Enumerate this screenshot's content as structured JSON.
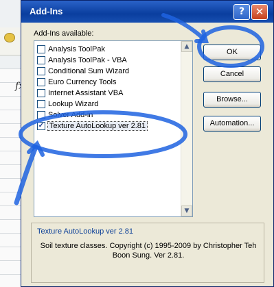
{
  "window": {
    "title": "Add-Ins",
    "help_glyph": "?",
    "close_glyph": "✕"
  },
  "background": {
    "formula_glyph": "fx"
  },
  "addins": {
    "label": "Add-Ins available:",
    "items": [
      {
        "label": "Analysis ToolPak",
        "checked": false
      },
      {
        "label": "Analysis ToolPak - VBA",
        "checked": false
      },
      {
        "label": "Conditional Sum Wizard",
        "checked": false
      },
      {
        "label": "Euro Currency Tools",
        "checked": false
      },
      {
        "label": "Internet Assistant VBA",
        "checked": false
      },
      {
        "label": "Lookup Wizard",
        "checked": false
      },
      {
        "label": "Solver Add-in",
        "checked": false
      },
      {
        "label": "Texture AutoLookup ver 2.81",
        "checked": true
      }
    ]
  },
  "buttons": {
    "ok": "OK",
    "cancel": "Cancel",
    "browse": "Browse...",
    "automation": "Automation..."
  },
  "description": {
    "title": "Texture AutoLookup ver 2.81",
    "text": "Soil texture classes. Copyright (c) 1995-2009 by Christopher Teh Boon Sung. Ver 2.81."
  },
  "scrollbar": {
    "up_glyph": "▲",
    "down_glyph": "▼"
  },
  "annotation_color": "#1e63e0"
}
